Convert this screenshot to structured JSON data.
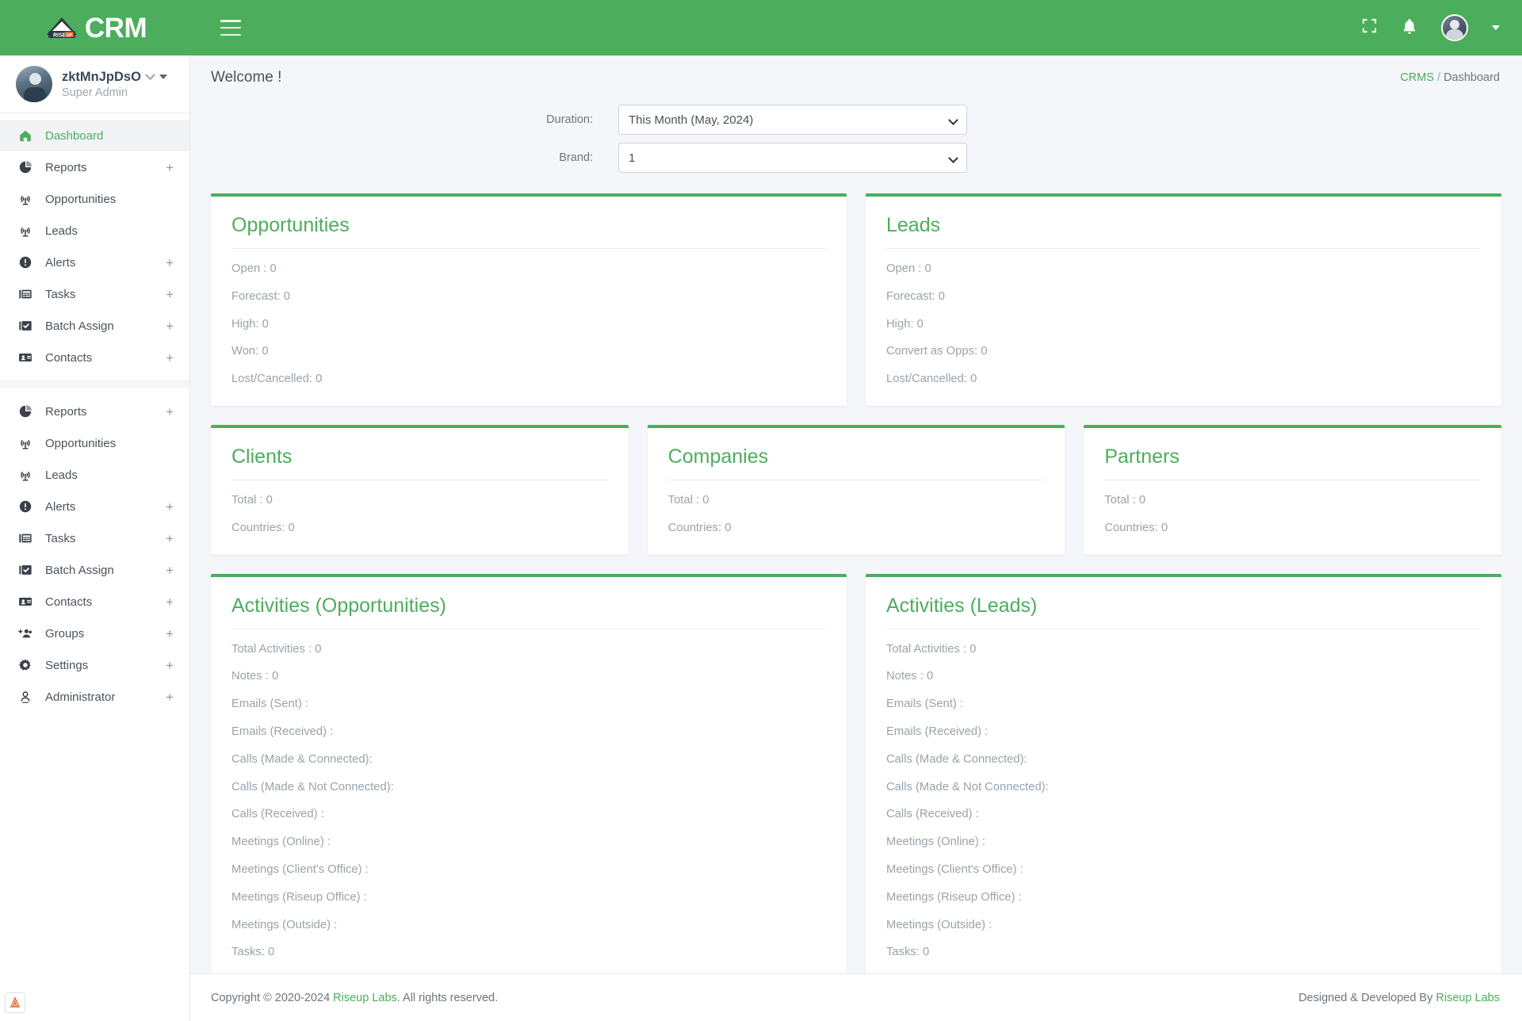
{
  "topbar": {
    "brand_text": "CRM",
    "brand_logo_name": "riseup-labs-logo",
    "menu_icon": "hamburger-icon",
    "fullscreen_icon": "fullscreen-icon",
    "notification_icon": "bell-icon",
    "avatar_icon": "user-avatar"
  },
  "sidebar": {
    "user": {
      "name": "zktMnJpDsO",
      "role": "Super Admin"
    },
    "groups": [
      {
        "items": [
          {
            "label": "Dashboard",
            "icon": "home-icon",
            "active": true,
            "expandable": false
          },
          {
            "label": "Reports",
            "icon": "pie-chart-icon",
            "active": false,
            "expandable": true
          },
          {
            "label": "Opportunities",
            "icon": "broadcast-icon",
            "active": false,
            "expandable": false
          },
          {
            "label": "Leads",
            "icon": "broadcast-icon",
            "active": false,
            "expandable": false
          },
          {
            "label": "Alerts",
            "icon": "alert-circle-icon",
            "active": false,
            "expandable": true
          },
          {
            "label": "Tasks",
            "icon": "task-board-icon",
            "active": false,
            "expandable": true
          },
          {
            "label": "Batch Assign",
            "icon": "checkbox-icon",
            "active": false,
            "expandable": true
          },
          {
            "label": "Contacts",
            "icon": "contact-card-icon",
            "active": false,
            "expandable": true
          }
        ]
      },
      {
        "items": [
          {
            "label": "Reports",
            "icon": "pie-chart-icon",
            "active": false,
            "expandable": true
          },
          {
            "label": "Opportunities",
            "icon": "broadcast-icon",
            "active": false,
            "expandable": false
          },
          {
            "label": "Leads",
            "icon": "broadcast-icon",
            "active": false,
            "expandable": false
          },
          {
            "label": "Alerts",
            "icon": "alert-circle-icon",
            "active": false,
            "expandable": true
          },
          {
            "label": "Tasks",
            "icon": "task-board-icon",
            "active": false,
            "expandable": true
          },
          {
            "label": "Batch Assign",
            "icon": "checkbox-icon",
            "active": false,
            "expandable": true
          },
          {
            "label": "Contacts",
            "icon": "contact-card-icon",
            "active": false,
            "expandable": true
          },
          {
            "label": "Groups",
            "icon": "add-group-icon",
            "active": false,
            "expandable": true
          },
          {
            "label": "Settings",
            "icon": "gear-icon",
            "active": false,
            "expandable": true
          },
          {
            "label": "Administrator",
            "icon": "person-icon",
            "active": false,
            "expandable": true
          }
        ]
      }
    ]
  },
  "page": {
    "welcome": "Welcome !",
    "breadcrumb_root": "CRMS",
    "breadcrumb_sep": "/",
    "breadcrumb_current": "Dashboard"
  },
  "filters": {
    "duration": {
      "label": "Duration:",
      "value": "This Month (May, 2024)"
    },
    "brand": {
      "label": "Brand:",
      "value": "1"
    }
  },
  "cards": {
    "opportunities": {
      "title": "Opportunities",
      "stats": [
        "Open : 0",
        "Forecast: 0",
        "High: 0",
        "Won: 0",
        "Lost/Cancelled: 0"
      ]
    },
    "leads": {
      "title": "Leads",
      "stats": [
        "Open : 0",
        "Forecast: 0",
        "High: 0",
        "Convert as Opps: 0",
        "Lost/Cancelled: 0"
      ]
    },
    "clients": {
      "title": "Clients",
      "stats": [
        "Total : 0",
        "Countries: 0"
      ]
    },
    "companies": {
      "title": "Companies",
      "stats": [
        "Total : 0",
        "Countries: 0"
      ]
    },
    "partners": {
      "title": "Partners",
      "stats": [
        "Total : 0",
        "Countries: 0"
      ]
    },
    "activities_opportunities": {
      "title": "Activities (Opportunities)",
      "stats": [
        "Total Activities : 0",
        "Notes : 0",
        "Emails (Sent) :",
        "Emails (Received) :",
        "Calls (Made & Connected):",
        "Calls (Made & Not Connected):",
        "Calls (Received) :",
        "Meetings (Online) :",
        "Meetings (Client's Office) :",
        "Meetings (Riseup Office) :",
        "Meetings (Outside) :",
        "Tasks: 0"
      ]
    },
    "activities_leads": {
      "title": "Activities (Leads)",
      "stats": [
        "Total Activities : 0",
        "Notes : 0",
        "Emails (Sent) :",
        "Emails (Received) :",
        "Calls (Made & Connected):",
        "Calls (Made & Not Connected):",
        "Calls (Received) :",
        "Meetings (Online) :",
        "Meetings (Client's Office) :",
        "Meetings (Riseup Office) :",
        "Meetings (Outside) :",
        "Tasks: 0"
      ]
    }
  },
  "footer": {
    "copyright_prefix": "Copyright © 2020-2024 ",
    "company": "Riseup Labs",
    "copyright_suffix": ". All rights reserved.",
    "designed_prefix": "Designed & Developed By ",
    "designed_company": "Riseup Labs"
  },
  "colors": {
    "accent": "#4cae5c",
    "page_bg": "#f4f6f9",
    "card_bg": "#ffffff",
    "muted_text": "#9aa3ab"
  }
}
